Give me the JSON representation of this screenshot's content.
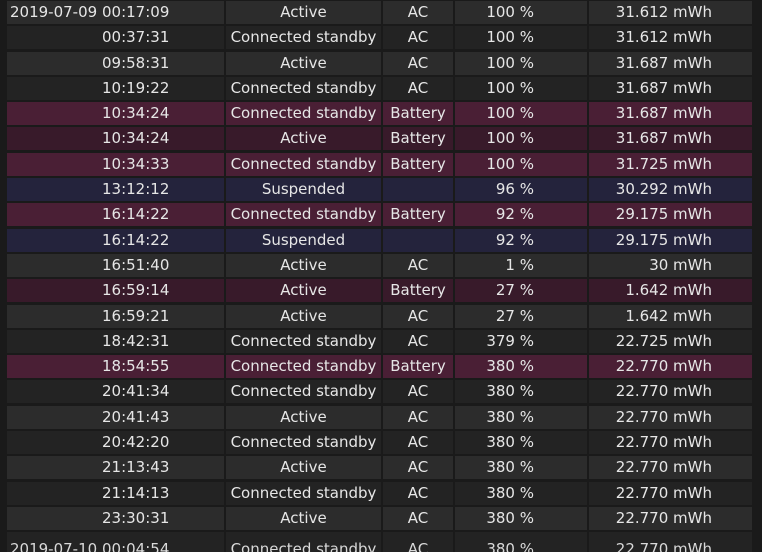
{
  "rows": [
    {
      "date": "2019-07-09",
      "time": "00:17:09",
      "state": "Active",
      "source": "AC",
      "percent": "100 %",
      "capacity": "31.612 mWh",
      "kind": "ac"
    },
    {
      "date": "",
      "time": "00:37:31",
      "state": "Connected standby",
      "source": "AC",
      "percent": "100 %",
      "capacity": "31.612 mWh",
      "kind": "ac"
    },
    {
      "date": "",
      "time": "09:58:31",
      "state": "Active",
      "source": "AC",
      "percent": "100 %",
      "capacity": "31.687 mWh",
      "kind": "ac"
    },
    {
      "date": "",
      "time": "10:19:22",
      "state": "Connected standby",
      "source": "AC",
      "percent": "100 %",
      "capacity": "31.687 mWh",
      "kind": "ac"
    },
    {
      "date": "",
      "time": "10:34:24",
      "state": "Connected standby",
      "source": "Battery",
      "percent": "100 %",
      "capacity": "31.687 mWh",
      "kind": "batt"
    },
    {
      "date": "",
      "time": "10:34:24",
      "state": "Active",
      "source": "Battery",
      "percent": "100 %",
      "capacity": "31.687 mWh",
      "kind": "batt"
    },
    {
      "date": "",
      "time": "10:34:33",
      "state": "Connected standby",
      "source": "Battery",
      "percent": "100 %",
      "capacity": "31.725 mWh",
      "kind": "batt"
    },
    {
      "date": "",
      "time": "13:12:12",
      "state": "Suspended",
      "source": "",
      "percent": "96 %",
      "capacity": "30.292 mWh",
      "kind": "susp"
    },
    {
      "date": "",
      "time": "16:14:22",
      "state": "Connected standby",
      "source": "Battery",
      "percent": "92 %",
      "capacity": "29.175 mWh",
      "kind": "batt"
    },
    {
      "date": "",
      "time": "16:14:22",
      "state": "Suspended",
      "source": "",
      "percent": "92 %",
      "capacity": "29.175 mWh",
      "kind": "susp"
    },
    {
      "date": "",
      "time": "16:51:40",
      "state": "Active",
      "source": "AC",
      "percent": "1 %",
      "capacity": "30 mWh",
      "kind": "ac"
    },
    {
      "date": "",
      "time": "16:59:14",
      "state": "Active",
      "source": "Battery",
      "percent": "27 %",
      "capacity": "1.642 mWh",
      "kind": "batt"
    },
    {
      "date": "",
      "time": "16:59:21",
      "state": "Active",
      "source": "AC",
      "percent": "27 %",
      "capacity": "1.642 mWh",
      "kind": "ac"
    },
    {
      "date": "",
      "time": "18:42:31",
      "state": "Connected standby",
      "source": "AC",
      "percent": "379 %",
      "capacity": "22.725 mWh",
      "kind": "ac"
    },
    {
      "date": "",
      "time": "18:54:55",
      "state": "Connected standby",
      "source": "Battery",
      "percent": "380 %",
      "capacity": "22.770 mWh",
      "kind": "batt"
    },
    {
      "date": "",
      "time": "20:41:34",
      "state": "Connected standby",
      "source": "AC",
      "percent": "380 %",
      "capacity": "22.770 mWh",
      "kind": "ac"
    },
    {
      "date": "",
      "time": "20:41:43",
      "state": "Active",
      "source": "AC",
      "percent": "380 %",
      "capacity": "22.770 mWh",
      "kind": "ac"
    },
    {
      "date": "",
      "time": "20:42:20",
      "state": "Connected standby",
      "source": "AC",
      "percent": "380 %",
      "capacity": "22.770 mWh",
      "kind": "ac"
    },
    {
      "date": "",
      "time": "21:13:43",
      "state": "Active",
      "source": "AC",
      "percent": "380 %",
      "capacity": "22.770 mWh",
      "kind": "ac"
    },
    {
      "date": "",
      "time": "21:14:13",
      "state": "Connected standby",
      "source": "AC",
      "percent": "380 %",
      "capacity": "22.770 mWh",
      "kind": "ac"
    },
    {
      "date": "",
      "time": "23:30:31",
      "state": "Active",
      "source": "AC",
      "percent": "380 %",
      "capacity": "22.770 mWh",
      "kind": "ac"
    },
    {
      "date": "2019-07-10",
      "time": "00:04:54",
      "state": "Connected standby",
      "source": "AC",
      "percent": "380 %",
      "capacity": "22.770 mWh",
      "kind": "ac"
    }
  ],
  "colors": {
    "background": "#1a1a1a",
    "ac_row": "#2c2c2c",
    "battery_row": "#4a1f35",
    "suspended_row": "#24233c",
    "text": "#e6e6e6"
  }
}
